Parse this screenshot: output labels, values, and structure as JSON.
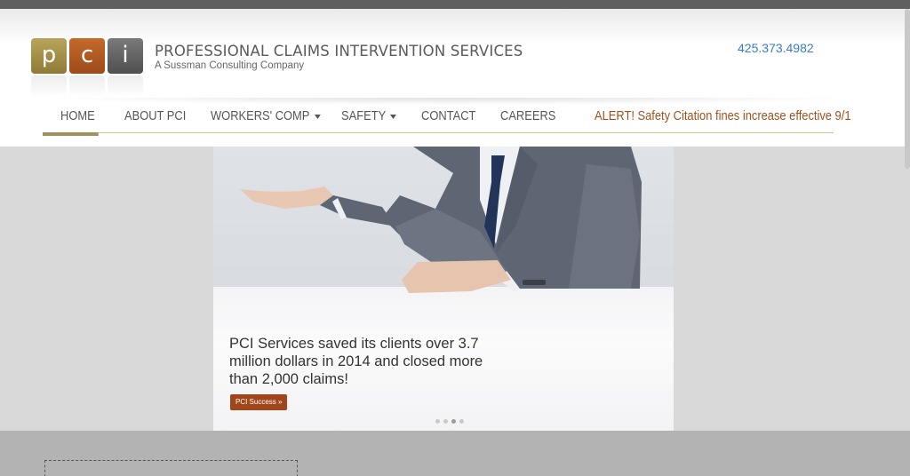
{
  "logo": {
    "letters": [
      "p",
      "c",
      "i"
    ]
  },
  "company": {
    "name": "PROFESSIONAL CLAIMS INTERVENTION SERVICES",
    "tagline": "A Sussman Consulting Company"
  },
  "phone": "425.373.4982",
  "nav": {
    "items": [
      {
        "label": "HOME",
        "active": true
      },
      {
        "label": "ABOUT PCI"
      },
      {
        "label": "WORKERS' COMP",
        "dropdown": true
      },
      {
        "label": "SAFETY",
        "dropdown": true
      },
      {
        "label": "CONTACT"
      },
      {
        "label": "CAREERS"
      }
    ],
    "alert": "ALERT! Safety Citation fines increase effective 9/1"
  },
  "hero": {
    "text": "PCI Services saved its clients over 3.7 million dollars in 2014 and closed more than 2,000 claims!",
    "button": "PCI Success »",
    "slide_count": 4,
    "active_slide": 3
  },
  "colors": {
    "accent_gold": "#a1915b",
    "accent_rust": "#a1461a",
    "link_blue": "#3a7bc8"
  }
}
